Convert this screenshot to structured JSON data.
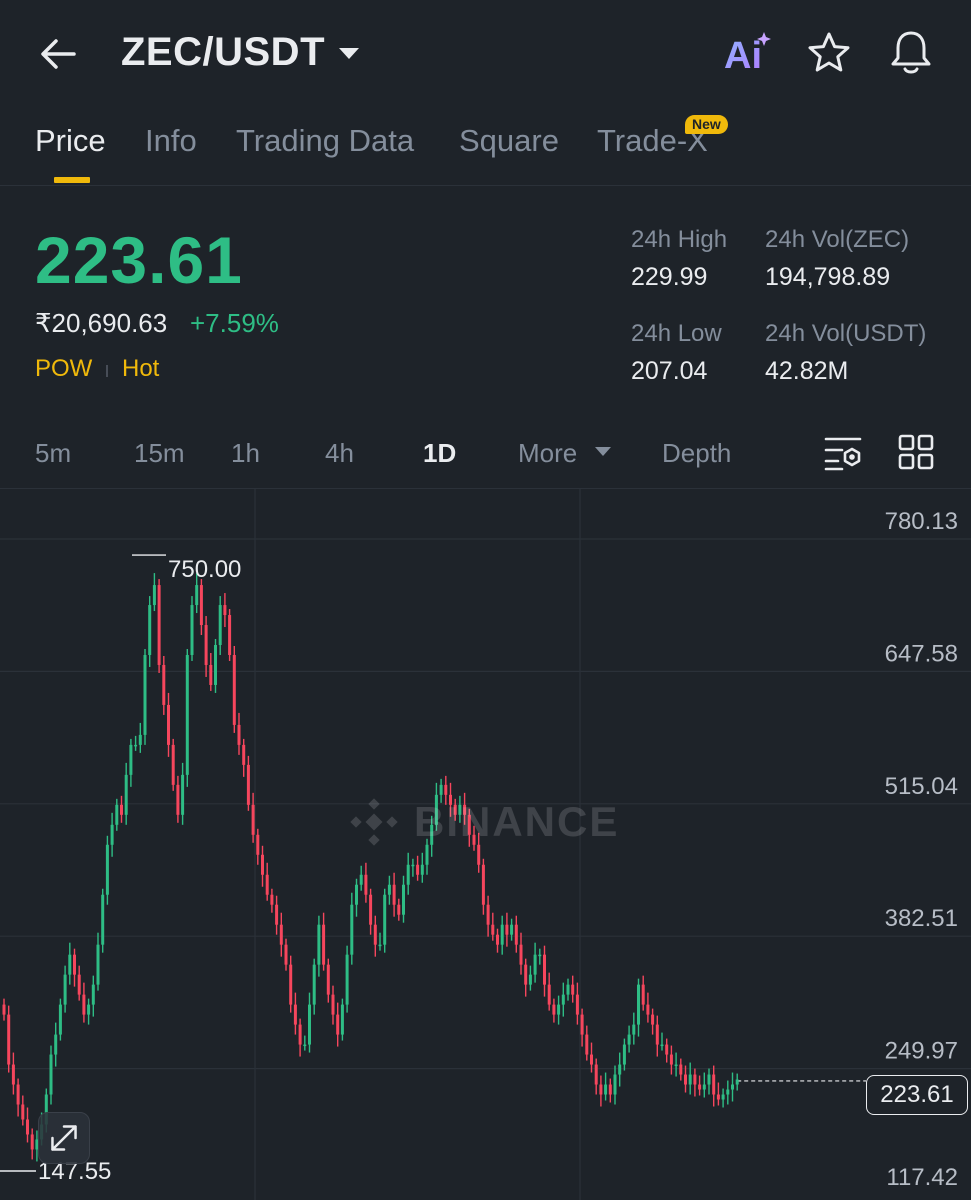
{
  "header": {
    "pair": "ZEC/USDT",
    "icons": [
      "back-arrow-icon",
      "caret-down-icon",
      "ai-icon",
      "star-icon",
      "bell-icon"
    ]
  },
  "tabs": [
    {
      "label": "Price",
      "active": true
    },
    {
      "label": "Info"
    },
    {
      "label": "Trading Data"
    },
    {
      "label": "Square"
    },
    {
      "label": "Trade-X",
      "badge": "New"
    }
  ],
  "ticker": {
    "price": "223.61",
    "fiat_price": "₹20,690.63",
    "change": "+7.59%",
    "tags": [
      "POW",
      "Hot"
    ],
    "stats": {
      "high_label": "24h High",
      "high": "229.99",
      "low_label": "24h Low",
      "low": "207.04",
      "vol_base_label": "24h Vol(ZEC)",
      "vol_base": "194,798.89",
      "vol_quote_label": "24h Vol(USDT)",
      "vol_quote": "42.82M"
    }
  },
  "intervals": {
    "items": [
      "5m",
      "15m",
      "1h",
      "4h",
      "1D",
      "More",
      "Depth"
    ],
    "active": "1D"
  },
  "colors": {
    "up": "#2ebd85",
    "down": "#f6465d",
    "accent": "#f0b90b",
    "bg": "#1e2329"
  },
  "chart_data": {
    "type": "candlestick",
    "interval": "1D",
    "y_ticks": [
      "780.13",
      "647.58",
      "515.04",
      "382.51",
      "249.97",
      "117.42"
    ],
    "ylim": [
      117.42,
      780.13
    ],
    "current_price": "223.61",
    "period_high": "750.00",
    "period_low": "147.55",
    "watermark": "BINANCE",
    "closes_approx": [
      290,
      240,
      220,
      200,
      185,
      170,
      155,
      165,
      180,
      210,
      250,
      270,
      300,
      330,
      350,
      330,
      310,
      290,
      300,
      320,
      360,
      410,
      460,
      480,
      500,
      490,
      530,
      560,
      560,
      570,
      650,
      700,
      720,
      640,
      600,
      560,
      520,
      490,
      530,
      650,
      700,
      720,
      680,
      640,
      620,
      660,
      700,
      690,
      650,
      580,
      560,
      540,
      500,
      470,
      450,
      430,
      410,
      400,
      380,
      360,
      340,
      300,
      280,
      260,
      260,
      300,
      340,
      380,
      340,
      310,
      290,
      270,
      300,
      350,
      400,
      420,
      430,
      410,
      380,
      360,
      360,
      410,
      420,
      400,
      390,
      420,
      440,
      440,
      430,
      440,
      460,
      480,
      510,
      520,
      510,
      500,
      490,
      500,
      490,
      470,
      460,
      440,
      400,
      380,
      370,
      360,
      380,
      370,
      380,
      360,
      340,
      320,
      330,
      350,
      350,
      320,
      300,
      290,
      300,
      310,
      320,
      310,
      290,
      270,
      250,
      240,
      220,
      210,
      220,
      210,
      230,
      240,
      260,
      270,
      280,
      320,
      300,
      290,
      280,
      260,
      260,
      250,
      240,
      240,
      230,
      220,
      230,
      220,
      215,
      220,
      230,
      210,
      205,
      210,
      215,
      220,
      225
    ]
  }
}
